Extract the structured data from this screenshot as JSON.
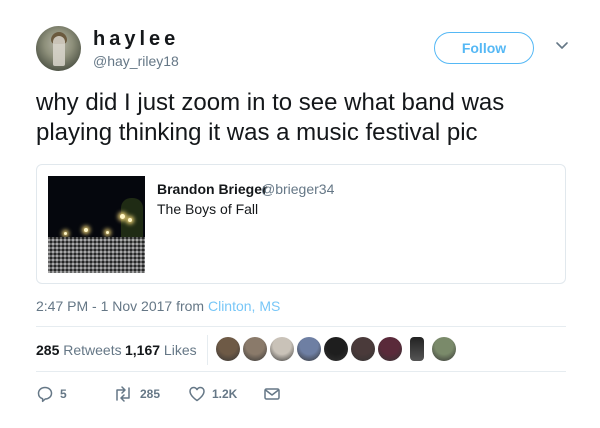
{
  "user": {
    "display_name": "haylee",
    "handle": "@hay_riley18"
  },
  "follow_button": {
    "label": "Follow"
  },
  "tweet": {
    "line1": "why did I just zoom in to see what band was",
    "line2": "playing thinking it was a music festival pic"
  },
  "quoted_tweet": {
    "name": "Brandon Brieger",
    "handle": "@brieger34",
    "text": "The Boys of Fall"
  },
  "meta": {
    "time_date": "2:47 PM - 1 Nov 2017 from ",
    "location": "Clinton, MS"
  },
  "stats": {
    "retweets_count": "285",
    "retweets_label": " Retweets",
    "likes_count": "1,167",
    "likes_label": " Likes",
    "liker_avatars": [
      "#6e5a46",
      "#8a7a6a",
      "#c9c2b8",
      "#6e7fa3",
      "#1e1e1e",
      "#4a3a3a",
      "#5a2a3a",
      "#ffffff",
      "#7a8a6a"
    ]
  },
  "actions": {
    "reply_count": "5",
    "retweet_count": "285",
    "like_count": "1.2K"
  },
  "colors": {
    "accent": "#1da1f2",
    "secondary_text": "#657786",
    "primary_text": "#14171a",
    "border": "#e1e8ed"
  }
}
